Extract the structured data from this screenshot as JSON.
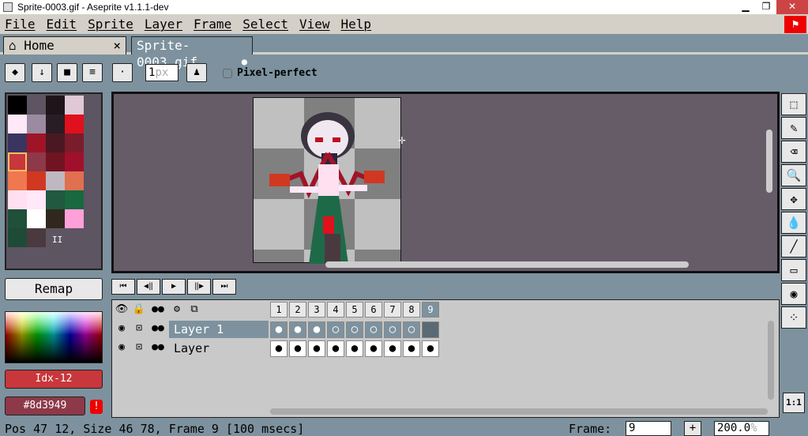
{
  "window": {
    "title": "Sprite-0003.gif - Aseprite v1.1.1-dev",
    "minimize": "▁",
    "maximize": "❐",
    "close": "✕"
  },
  "menu": [
    "File",
    "Edit",
    "Sprite",
    "Layer",
    "Frame",
    "Select",
    "View",
    "Help"
  ],
  "flag_icon": "red-flag",
  "tabs": [
    {
      "label": "Home",
      "icon": "home-icon",
      "close": "×"
    },
    {
      "label": "Sprite-0003.gif",
      "modified": "●"
    }
  ],
  "tool_options": {
    "brush_size_value": "1",
    "brush_size_unit": "px",
    "pixel_perfect_label": "Pixel-perfect"
  },
  "palette": {
    "colors": [
      "#000000",
      "#5d5561",
      "#1f1419",
      "#e0c8d6",
      "#ffe8f8",
      "#9b8aa0",
      "#2a1c24",
      "#e0101c",
      "#3a3460",
      "#a01428",
      "#4a1822",
      "#7a1c2a",
      "#c8373b",
      "#8d3949",
      "#701422",
      "#a0102c",
      "#f07850",
      "#d03822",
      "#c0b8c0",
      "#e07050",
      "#ffe0f0",
      "#ffe8f8",
      "#205840",
      "#186840",
      "#205038",
      "#ffffff",
      "#30281e",
      "#ffa0d8",
      "#1e4a38",
      "#4a3a40"
    ],
    "selected_index": 12,
    "more_indicator": "II"
  },
  "remap_label": "Remap",
  "color_index_label": "Idx-12",
  "color_hex_label": "#8d3949",
  "warning_glyph": "!",
  "animation_controls": [
    "⏮",
    "◀‖",
    "▶",
    "‖▶",
    "⏭"
  ],
  "timeline": {
    "header_icons": [
      "👁",
      "🔒",
      "●●",
      "⚙",
      "⧉"
    ],
    "frames": [
      "1",
      "2",
      "3",
      "4",
      "5",
      "6",
      "7",
      "8",
      "9"
    ],
    "current_frame_index": 8,
    "layers": [
      {
        "name": "Layer 1",
        "selected": true,
        "cels": [
          "●",
          "●",
          "●",
          "○",
          "○",
          "○",
          "○",
          "○",
          ""
        ]
      },
      {
        "name": "Layer",
        "selected": false,
        "cels": [
          "●",
          "●",
          "●",
          "●",
          "●",
          "●",
          "●",
          "●",
          "●"
        ]
      }
    ]
  },
  "tools": [
    "marquee-icon",
    "pencil-icon",
    "eraser-icon",
    "zoom-icon",
    "move-icon",
    "fill-icon",
    "line-icon",
    "rectangle-icon",
    "blur-icon",
    "spray-icon"
  ],
  "tool_glyphs": [
    "⬚",
    "✎",
    "⌫",
    "🔍",
    "✥",
    "💧",
    "╱",
    "▭",
    "◉",
    "⁘"
  ],
  "one_to_one_label": "1:1",
  "status": {
    "text": "Pos 47 12, Size 46 78, Frame 9 [100 msecs]",
    "frame_label": "Frame:",
    "frame_value": "9",
    "plus": "+",
    "zoom_value": "200.0",
    "zoom_unit": "%"
  }
}
